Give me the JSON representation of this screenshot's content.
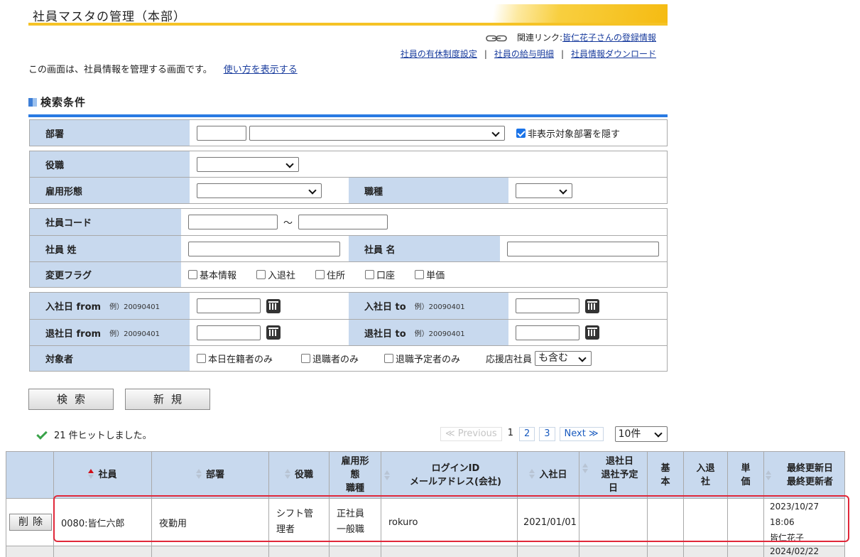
{
  "header": {
    "title": "社員マスタの管理（本部）"
  },
  "related": {
    "label": "関連リンク:",
    "link": "皆仁花子さんの登録情報",
    "sub_links": [
      "社員の有休制度設定",
      "社員の給与明細",
      "社員情報ダウンロード"
    ]
  },
  "description": {
    "text": "この画面は、社員情報を管理する画面です。",
    "help_link": "使い方を表示する"
  },
  "search": {
    "title": "検索条件",
    "department_label": "部署",
    "hide_dept_label": "非表示対象部署を隠す",
    "position_label": "役職",
    "employment_label": "雇用形態",
    "job_type_label": "職種",
    "code_label": "社員コード",
    "tilde": "～",
    "last_name_label": "社員 姓",
    "first_name_label": "社員 名",
    "change_flag_label": "変更フラグ",
    "flags": [
      "基本情報",
      "入退社",
      "住所",
      "口座",
      "単価"
    ],
    "hire_from_label": "入社日 from",
    "hire_to_label": "入社日 to",
    "leave_from_label": "退社日 from",
    "leave_to_label": "退社日 to",
    "example": "例）20090401",
    "target_label": "対象者",
    "targets": [
      "本日在籍者のみ",
      "退職者のみ",
      "退職予定者のみ"
    ],
    "support_staff_label": "応援店社員",
    "support_staff_value": "も含む"
  },
  "buttons": {
    "search": "検索",
    "new": "新規"
  },
  "results": {
    "hit_text": "21 件ヒットしました。",
    "pager": {
      "prev": "≪ Previous",
      "pages": [
        "1",
        "2",
        "3"
      ],
      "next": "Next ≫",
      "per_page": "10件"
    },
    "headers": {
      "employee": "社員",
      "department": "部署",
      "position": "役職",
      "employment_a": "雇用形",
      "employment_b": "態",
      "employment_c": "職種",
      "login_a": "ログインID",
      "login_b": "メールアドレス(会社)",
      "hire_date": "入社日",
      "leave_a": "退社日",
      "leave_b": "退社予定",
      "leave_c": "日",
      "basic_a": "基",
      "basic_b": "本",
      "inout_a": "入退",
      "inout_b": "社",
      "price_a": "単",
      "price_b": "価",
      "updated_a": "最終更新日",
      "updated_b": "最終更新者"
    },
    "rows": [
      {
        "delete_label": "削除",
        "employee": "0080:皆仁六郎",
        "department": "夜勤用",
        "position": "シフト管理者",
        "employment": "正社員",
        "job_type": "一般職",
        "login": "rokuro",
        "hire_date": "2021/01/01",
        "updated_date": "2023/10/27",
        "updated_time": "18:06",
        "updated_by": "皆仁花子"
      },
      {
        "updated_date": "2024/02/22"
      }
    ]
  },
  "colors": {
    "header_bar": "#f5c326",
    "label_bg": "#c8d9ee",
    "accent_blue": "#2a7ae2",
    "highlight": "#e0283a"
  }
}
